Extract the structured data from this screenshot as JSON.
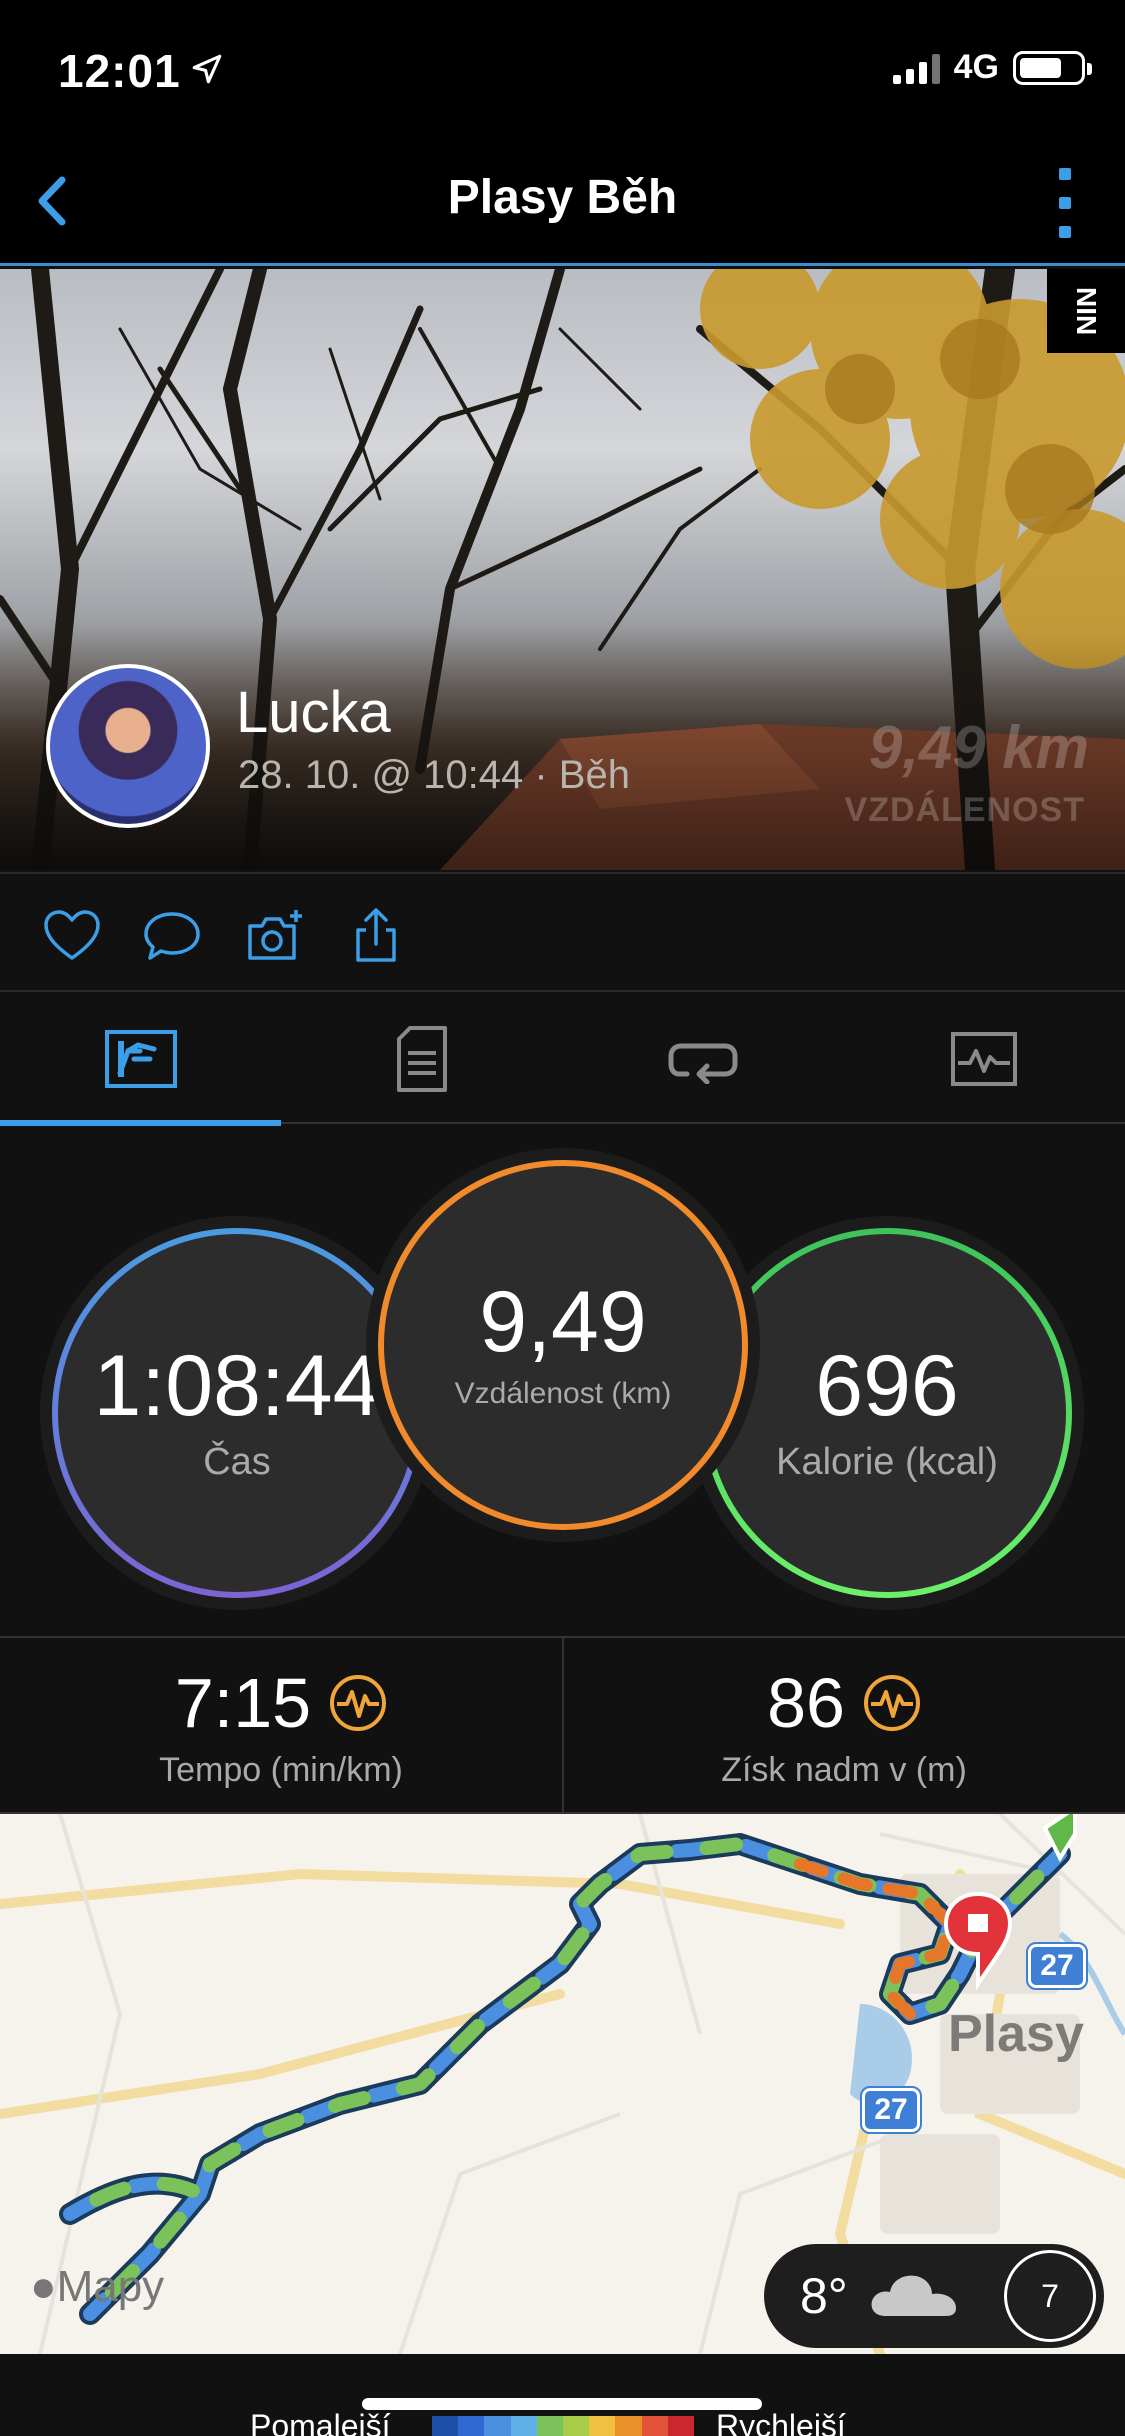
{
  "status_bar": {
    "time": "12:01",
    "network": "4G",
    "battery_level": 0.7
  },
  "nav": {
    "title": "Plasy Běh"
  },
  "hero": {
    "badge": "NIN",
    "user_name": "Lucka",
    "meta": "28. 10. @ 10:44 · Běh",
    "distance_watermark": "9,49 km",
    "distance_watermark_label": "VZDÁLENOST"
  },
  "actions": [
    "heart-icon",
    "comment-icon",
    "camera-add-icon",
    "share-icon"
  ],
  "tabs": [
    {
      "icon": "summary-icon",
      "active": true
    },
    {
      "icon": "details-icon",
      "active": false
    },
    {
      "icon": "laps-icon",
      "active": false
    },
    {
      "icon": "charts-icon",
      "active": false
    }
  ],
  "stats": {
    "time": {
      "value": "1:08:44",
      "label": "Čas"
    },
    "distance": {
      "value": "9,49",
      "label": "Vzdálenost (km)"
    },
    "calories": {
      "value": "696",
      "label": "Kalorie (kcal)"
    }
  },
  "metrics": {
    "pace": {
      "value": "7:15",
      "label": "Tempo (min/km)"
    },
    "elevation": {
      "value": "86",
      "label": "Získ nadm v (m)"
    }
  },
  "map": {
    "town_label": "Plasy",
    "road_badges": [
      "27",
      "27"
    ],
    "provider": "Mapy",
    "weather": {
      "temp": "8°",
      "wind": "7"
    }
  },
  "legend": {
    "slower": "Pomalejší",
    "faster": "Rychlejší"
  },
  "colors": {
    "accent": "#3b9ee6",
    "distance_ring": "#f08a2a",
    "calories_ring": "#4fd85e",
    "time_ring": "#6f7fdc",
    "start_pin": "#5fb848",
    "end_pin": "#e2333a"
  }
}
